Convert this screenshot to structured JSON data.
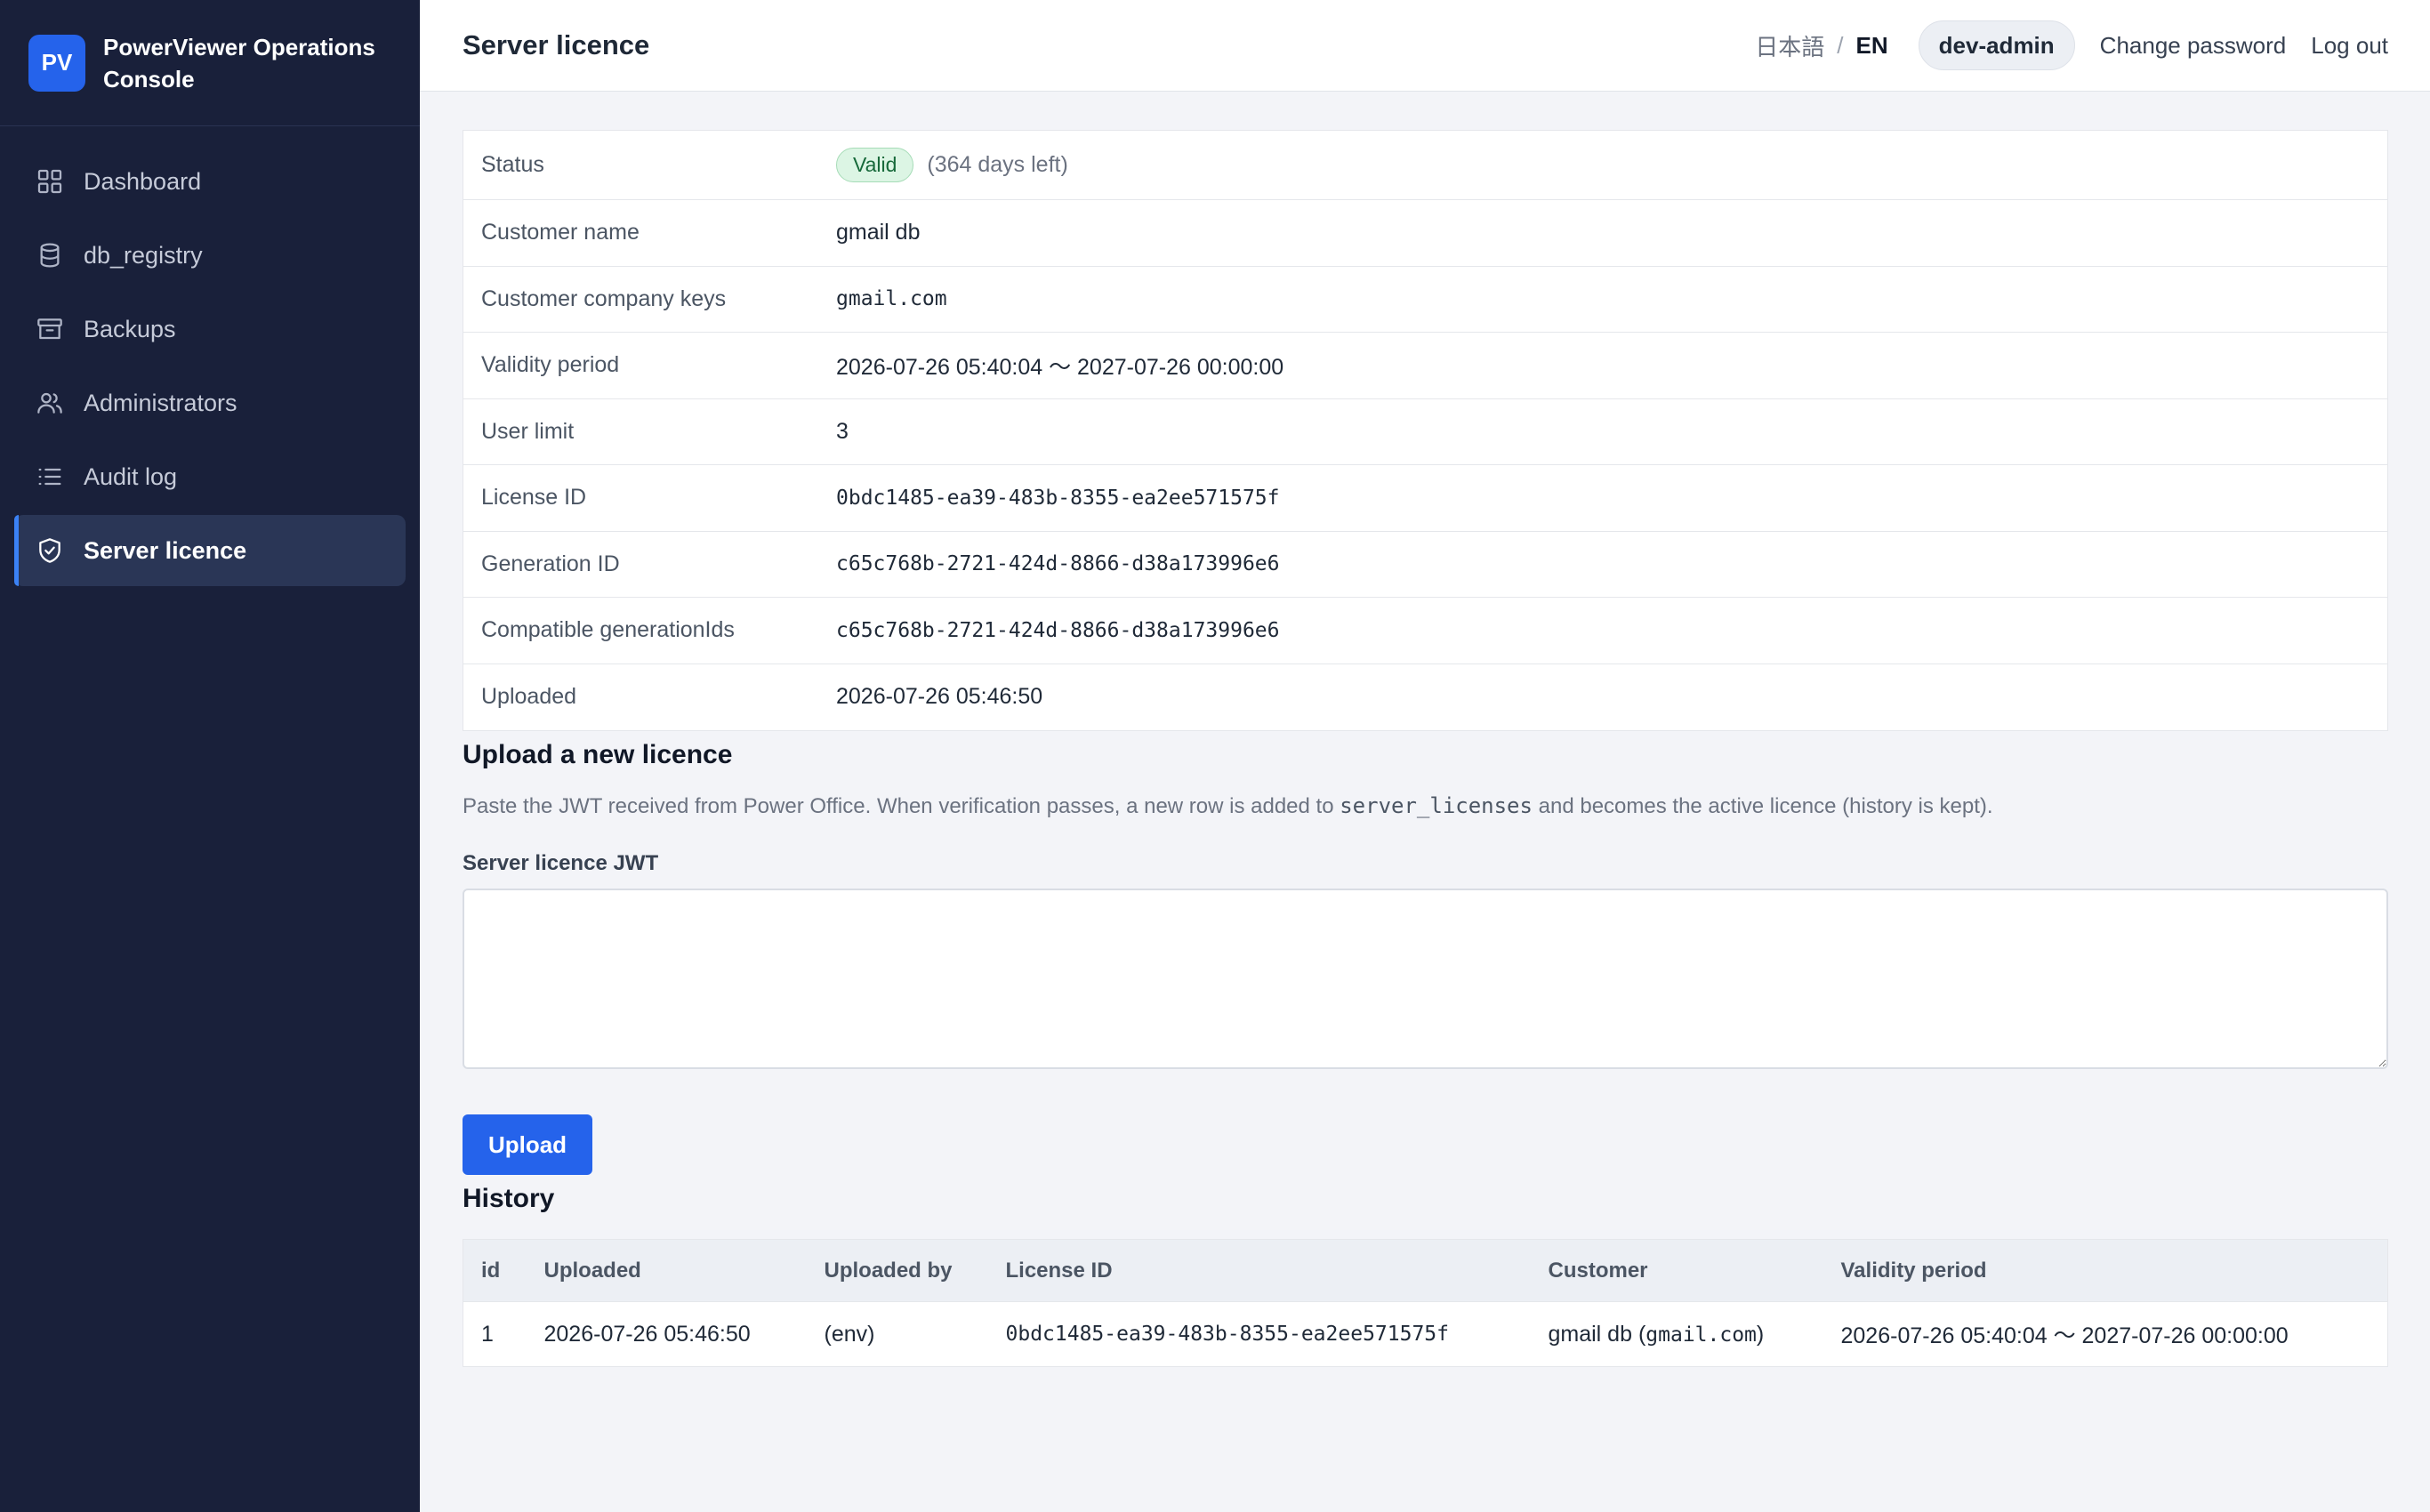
{
  "brand": {
    "logo": "PV",
    "name": "PowerViewer Operations Console"
  },
  "sidebar": {
    "items": [
      {
        "label": "Dashboard",
        "icon": "dashboard-grid-icon"
      },
      {
        "label": "db_registry",
        "icon": "database-icon"
      },
      {
        "label": "Backups",
        "icon": "archive-box-icon"
      },
      {
        "label": "Administrators",
        "icon": "users-icon"
      },
      {
        "label": "Audit log",
        "icon": "list-icon"
      },
      {
        "label": "Server licence",
        "icon": "shield-check-icon",
        "active": true
      }
    ]
  },
  "header": {
    "title": "Server licence",
    "lang_ja": "日本語",
    "lang_sep": "/",
    "lang_en": "EN",
    "user": "dev-admin",
    "change_password": "Change password",
    "logout": "Log out"
  },
  "licence": {
    "status": {
      "label": "Status",
      "badge": "Valid",
      "days_left": "(364 days left)"
    },
    "customer_name": {
      "label": "Customer name",
      "value": "gmail db"
    },
    "company_keys": {
      "label": "Customer company keys",
      "value": "gmail.com"
    },
    "validity": {
      "label": "Validity period",
      "value": "2026-07-26 05:40:04 〜 2027-07-26 00:00:00"
    },
    "user_limit": {
      "label": "User limit",
      "value": "3"
    },
    "license_id": {
      "label": "License ID",
      "value": "0bdc1485-ea39-483b-8355-ea2ee571575f"
    },
    "generation_id": {
      "label": "Generation ID",
      "value": "c65c768b-2721-424d-8866-d38a173996e6"
    },
    "compatible": {
      "label": "Compatible generationIds",
      "value": "c65c768b-2721-424d-8866-d38a173996e6"
    },
    "uploaded": {
      "label": "Uploaded",
      "value": "2026-07-26 05:46:50"
    }
  },
  "upload": {
    "title": "Upload a new licence",
    "desc_before": "Paste the JWT received from Power Office. When verification passes, a new row is added to ",
    "desc_code": "server_licenses",
    "desc_after": " and becomes the active licence (history is kept).",
    "field_label": "Server licence JWT",
    "input_value": "",
    "button": "Upload"
  },
  "history": {
    "title": "History",
    "columns": [
      "id",
      "Uploaded",
      "Uploaded by",
      "License ID",
      "Customer",
      "Validity period"
    ],
    "rows": [
      {
        "id": "1",
        "uploaded": "2026-07-26 05:46:50",
        "uploaded_by": "(env)",
        "license_id": "0bdc1485-ea39-483b-8355-ea2ee571575f",
        "customer_name": "gmail db",
        "customer_open": " (",
        "customer_key": "gmail.com",
        "customer_close": ")",
        "validity": "2026-07-26 05:40:04 〜 2027-07-26 00:00:00"
      }
    ]
  },
  "colors": {
    "sidebar_bg": "#19203a",
    "accent": "#2563eb",
    "valid_badge_bg": "#dcf5e4",
    "valid_badge_text": "#17693a"
  }
}
